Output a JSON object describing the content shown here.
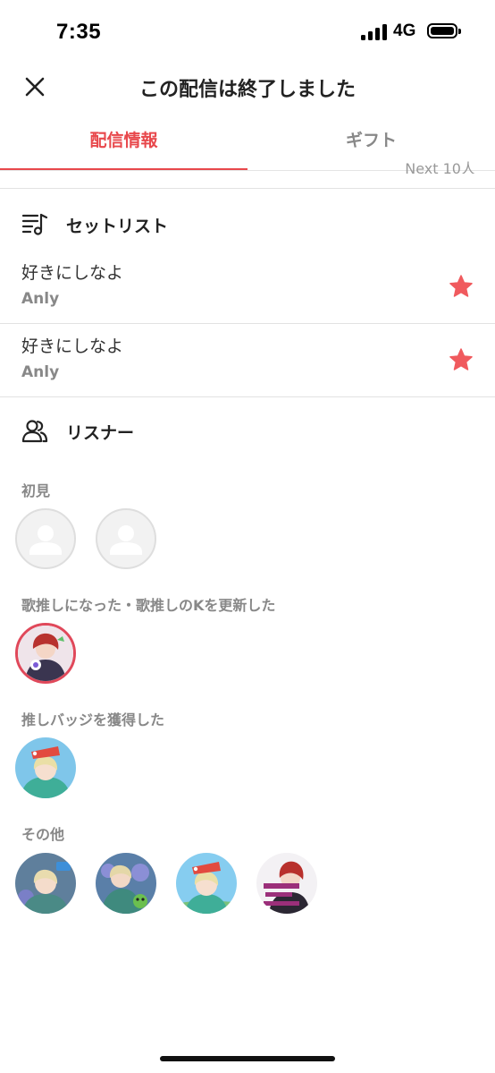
{
  "status_bar": {
    "time": "7:35",
    "network": "4G"
  },
  "header": {
    "title": "この配信は終了しました"
  },
  "tabs": [
    {
      "label": "配信情報"
    },
    {
      "label": "ギフト"
    }
  ],
  "top_peek_text": "Next 10人",
  "setlist": {
    "heading": "セットリスト",
    "songs": [
      {
        "title": "好きにしなよ",
        "artist": "Anly"
      },
      {
        "title": "好きにしなよ",
        "artist": "Anly"
      }
    ]
  },
  "listeners": {
    "heading": "リスナー",
    "groups": [
      {
        "label": "初見"
      },
      {
        "label": "歌推しになった・歌推しのKを更新した"
      },
      {
        "label": "推しバッジを獲得した"
      },
      {
        "label": "その他"
      }
    ]
  },
  "colors": {
    "accent": "#e8484c",
    "star": "#f05a5e",
    "muted": "#888888"
  }
}
